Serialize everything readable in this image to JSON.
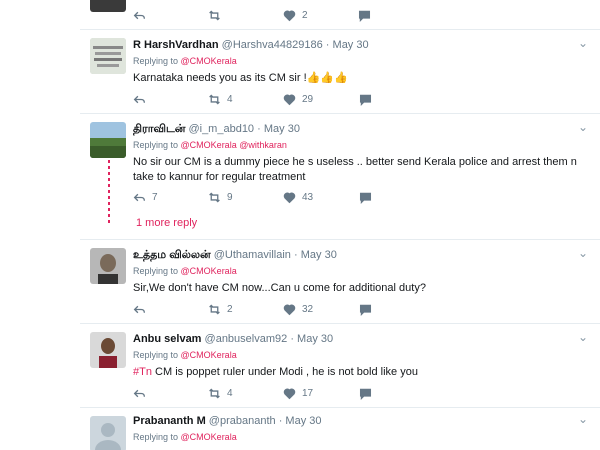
{
  "tweets": [
    {
      "name": "",
      "handle": "",
      "time": "",
      "replying": [],
      "text": "",
      "counts": {
        "reply": "",
        "retweet": "",
        "like": "2"
      }
    },
    {
      "name": "R HarshVardhan",
      "handle": "@Harshva44829186",
      "time": "May 30",
      "replying_label": "Replying to",
      "replying": [
        "@CMOKerala"
      ],
      "text": "Karnataka needs you as its CM sir !👍👍👍",
      "counts": {
        "reply": "",
        "retweet": "4",
        "like": "29"
      }
    },
    {
      "name": "திராவிடன்",
      "handle": "@i_m_abd10",
      "time": "May 30",
      "replying_label": "Replying to",
      "replying": [
        "@CMOKerala",
        "@withkaran"
      ],
      "text": "No sir our CM is a dummy piece he s useless .. better send Kerala police and arrest them n take to kannur for regular treatment",
      "counts": {
        "reply": "7",
        "retweet": "9",
        "like": "43"
      }
    },
    {
      "name": "உத்தம வில்லன்",
      "handle": "@Uthamavillain",
      "time": "May 30",
      "replying_label": "Replying to",
      "replying": [
        "@CMOKerala"
      ],
      "text": "Sir,We don't have CM now...Can u come for additional duty?",
      "counts": {
        "reply": "",
        "retweet": "2",
        "like": "32"
      }
    },
    {
      "name": "Anbu selvam",
      "handle": "@anbuselvam92",
      "time": "May 30",
      "replying_label": "Replying to",
      "replying": [
        "@CMOKerala"
      ],
      "hashtag": "#Tn",
      "text": " CM is poppet ruler under Modi , he is not bold like you",
      "counts": {
        "reply": "",
        "retweet": "4",
        "like": "17"
      }
    },
    {
      "name": "Prabananth M",
      "handle": "@prabananth",
      "time": "May 30",
      "replying_label": "Replying to",
      "replying": [
        "@CMOKerala"
      ],
      "text": "",
      "counts": {
        "reply": "",
        "retweet": "",
        "like": ""
      }
    }
  ],
  "more_reply": "1 more reply",
  "separator": "·",
  "icons": [
    "reply-icon",
    "retweet-icon",
    "like-icon",
    "dm-icon",
    "caret-down-icon"
  ],
  "colors": {
    "accent": "#e0245e",
    "muted": "#657786",
    "border": "#e6ecf0"
  }
}
